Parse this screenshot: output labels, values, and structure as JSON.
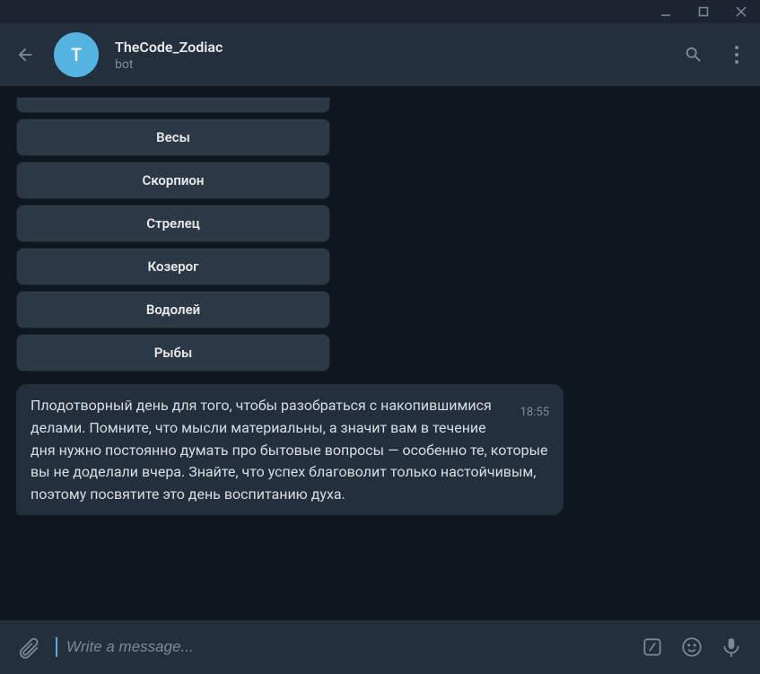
{
  "titlebar": {},
  "header": {
    "avatar_initial": "T",
    "title": "TheCode_Zodiac",
    "subtitle": "bot"
  },
  "keyboard": {
    "buttons": [
      "Весы",
      "Скорпион",
      "Стрелец",
      "Козерог",
      "Водолей",
      "Рыбы"
    ]
  },
  "message": {
    "text": "Плодотворный день для того, чтобы разобраться с накопившимися делами. Помните, что мысли материальны, а значит вам в течение дня нужно постоянно думать про бытовые вопросы — особенно те, которые вы не доделали вчера. Знайте, что успех благоволит только настойчивым, поэтому посвятите это день воспитанию духа.",
    "time": "18:55"
  },
  "composer": {
    "placeholder": "Write a message..."
  }
}
